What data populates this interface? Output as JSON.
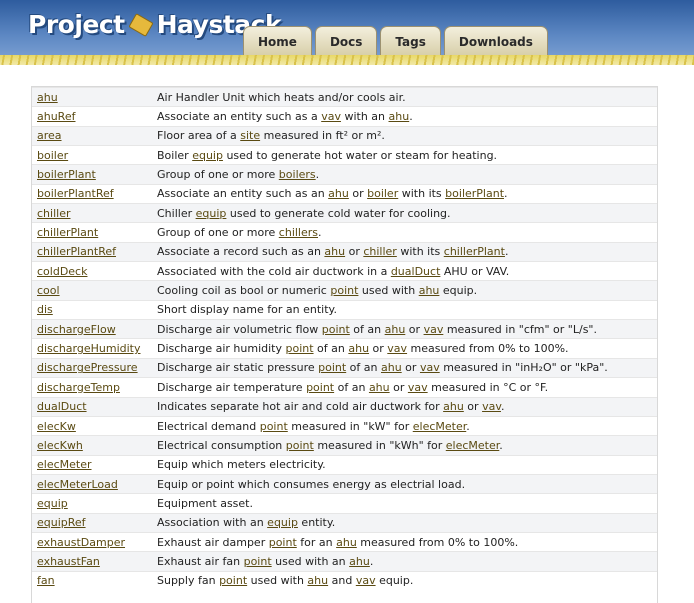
{
  "header": {
    "logo_text_1": "Project",
    "logo_text_2": "Haystack",
    "tabs": [
      {
        "label": "Home"
      },
      {
        "label": "Docs"
      },
      {
        "label": "Tags"
      },
      {
        "label": "Downloads"
      }
    ]
  },
  "tags": [
    {
      "name": "ahu",
      "desc": [
        {
          "t": "Air Handler Unit which heats and/or cools air."
        }
      ]
    },
    {
      "name": "ahuRef",
      "desc": [
        {
          "t": "Associate an entity such as a "
        },
        {
          "l": "vav"
        },
        {
          "t": " with an "
        },
        {
          "l": "ahu"
        },
        {
          "t": "."
        }
      ]
    },
    {
      "name": "area",
      "desc": [
        {
          "t": "Floor area of a "
        },
        {
          "l": "site"
        },
        {
          "t": " measured in ft² or m²."
        }
      ]
    },
    {
      "name": "boiler",
      "desc": [
        {
          "t": "Boiler "
        },
        {
          "l": "equip"
        },
        {
          "t": " used to generate hot water or steam for heating."
        }
      ]
    },
    {
      "name": "boilerPlant",
      "desc": [
        {
          "t": "Group of one or more "
        },
        {
          "l": "boilers"
        },
        {
          "t": "."
        }
      ]
    },
    {
      "name": "boilerPlantRef",
      "desc": [
        {
          "t": "Associate an entity such as an "
        },
        {
          "l": "ahu"
        },
        {
          "t": " or "
        },
        {
          "l": "boiler"
        },
        {
          "t": " with its "
        },
        {
          "l": "boilerPlant"
        },
        {
          "t": "."
        }
      ]
    },
    {
      "name": "chiller",
      "desc": [
        {
          "t": "Chiller "
        },
        {
          "l": "equip"
        },
        {
          "t": " used to generate cold water for cooling."
        }
      ]
    },
    {
      "name": "chillerPlant",
      "desc": [
        {
          "t": "Group of one or more "
        },
        {
          "l": "chillers"
        },
        {
          "t": "."
        }
      ]
    },
    {
      "name": "chillerPlantRef",
      "desc": [
        {
          "t": "Associate a record such as an "
        },
        {
          "l": "ahu"
        },
        {
          "t": " or "
        },
        {
          "l": "chiller"
        },
        {
          "t": " with its "
        },
        {
          "l": "chillerPlant"
        },
        {
          "t": "."
        }
      ]
    },
    {
      "name": "coldDeck",
      "desc": [
        {
          "t": "Associated with the cold air ductwork in a "
        },
        {
          "l": "dualDuct"
        },
        {
          "t": " AHU or VAV."
        }
      ]
    },
    {
      "name": "cool",
      "desc": [
        {
          "t": "Cooling coil as bool or numeric "
        },
        {
          "l": "point"
        },
        {
          "t": " used with "
        },
        {
          "l": "ahu"
        },
        {
          "t": " equip."
        }
      ]
    },
    {
      "name": "dis",
      "desc": [
        {
          "t": "Short display name for an entity."
        }
      ]
    },
    {
      "name": "dischargeFlow",
      "desc": [
        {
          "t": "Discharge air volumetric flow "
        },
        {
          "l": "point"
        },
        {
          "t": " of an "
        },
        {
          "l": "ahu"
        },
        {
          "t": " or "
        },
        {
          "l": "vav"
        },
        {
          "t": " measured in \"cfm\" or \"L/s\"."
        }
      ]
    },
    {
      "name": "dischargeHumidity",
      "desc": [
        {
          "t": "Discharge air humidity "
        },
        {
          "l": "point"
        },
        {
          "t": " of an "
        },
        {
          "l": "ahu"
        },
        {
          "t": " or "
        },
        {
          "l": "vav"
        },
        {
          "t": " measured from 0% to 100%."
        }
      ]
    },
    {
      "name": "dischargePressure",
      "desc": [
        {
          "t": "Discharge air static pressure "
        },
        {
          "l": "point"
        },
        {
          "t": " of an "
        },
        {
          "l": "ahu"
        },
        {
          "t": " or "
        },
        {
          "l": "vav"
        },
        {
          "t": " measured in \"inH₂O\" or \"kPa\"."
        }
      ]
    },
    {
      "name": "dischargeTemp",
      "desc": [
        {
          "t": "Discharge air temperature "
        },
        {
          "l": "point"
        },
        {
          "t": " of an "
        },
        {
          "l": "ahu"
        },
        {
          "t": " or "
        },
        {
          "l": "vav"
        },
        {
          "t": " measured in °C or °F."
        }
      ]
    },
    {
      "name": "dualDuct",
      "desc": [
        {
          "t": "Indicates separate hot air and cold air ductwork for "
        },
        {
          "l": "ahu"
        },
        {
          "t": " or "
        },
        {
          "l": "vav"
        },
        {
          "t": "."
        }
      ]
    },
    {
      "name": "elecKw",
      "desc": [
        {
          "t": "Electrical demand "
        },
        {
          "l": "point"
        },
        {
          "t": " measured in \"kW\" for "
        },
        {
          "l": "elecMeter"
        },
        {
          "t": "."
        }
      ]
    },
    {
      "name": "elecKwh",
      "desc": [
        {
          "t": "Electrical consumption "
        },
        {
          "l": "point"
        },
        {
          "t": " measured in \"kWh\" for "
        },
        {
          "l": "elecMeter"
        },
        {
          "t": "."
        }
      ]
    },
    {
      "name": "elecMeter",
      "desc": [
        {
          "t": "Equip which meters electricity."
        }
      ]
    },
    {
      "name": "elecMeterLoad",
      "desc": [
        {
          "t": "Equip or point which consumes energy as electrial load."
        }
      ]
    },
    {
      "name": "equip",
      "desc": [
        {
          "t": "Equipment asset."
        }
      ]
    },
    {
      "name": "equipRef",
      "desc": [
        {
          "t": "Association with an "
        },
        {
          "l": "equip"
        },
        {
          "t": " entity."
        }
      ]
    },
    {
      "name": "exhaustDamper",
      "desc": [
        {
          "t": "Exhaust air damper "
        },
        {
          "l": "point"
        },
        {
          "t": " for an "
        },
        {
          "l": "ahu"
        },
        {
          "t": " measured from 0% to 100%."
        }
      ]
    },
    {
      "name": "exhaustFan",
      "desc": [
        {
          "t": "Exhaust air fan "
        },
        {
          "l": "point"
        },
        {
          "t": " used with an "
        },
        {
          "l": "ahu"
        },
        {
          "t": "."
        }
      ]
    },
    {
      "name": "fan",
      "desc": [
        {
          "t": "Supply fan "
        },
        {
          "l": "point"
        },
        {
          "t": " used with "
        },
        {
          "l": "ahu"
        },
        {
          "t": " and "
        },
        {
          "l": "vav"
        },
        {
          "t": " equip."
        }
      ]
    }
  ]
}
